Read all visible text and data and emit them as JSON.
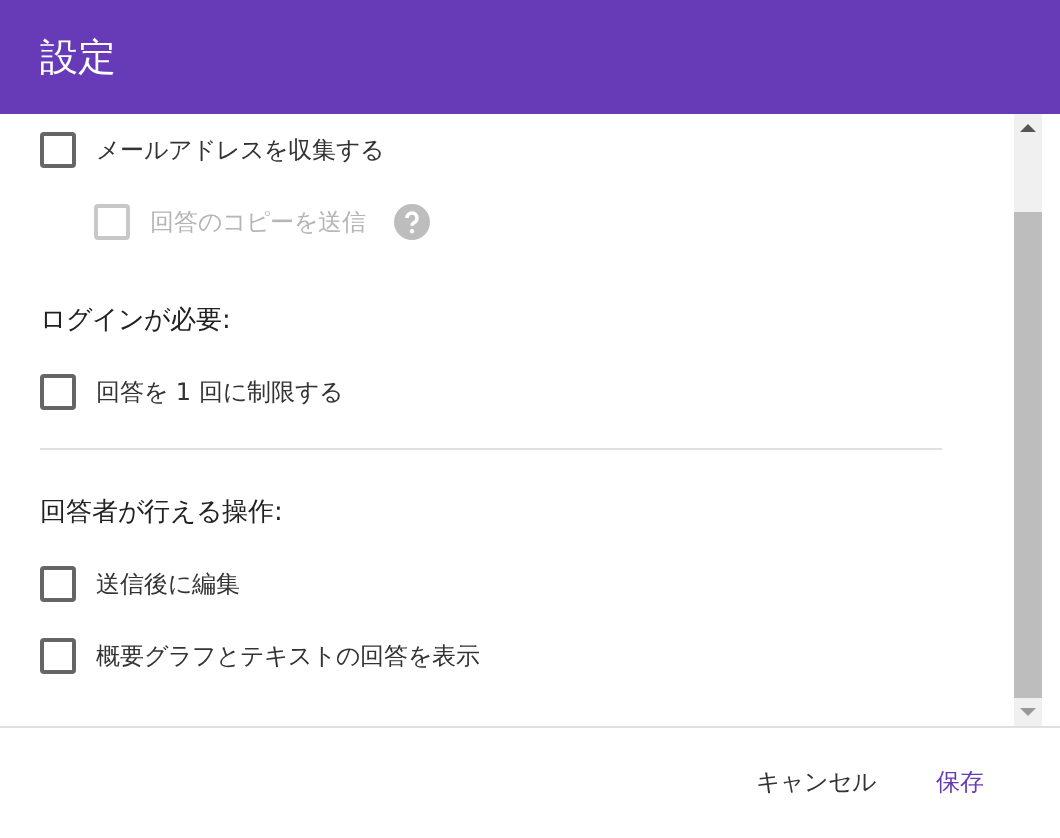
{
  "dialog": {
    "title": "設定"
  },
  "sections": [
    {
      "items": [
        {
          "label": "メールアドレスを収集する",
          "checked": false,
          "disabled": false,
          "children": [
            {
              "label": "回答のコピーを送信",
              "checked": false,
              "disabled": true,
              "help": true
            }
          ]
        }
      ]
    },
    {
      "heading": "ログインが必要:",
      "items": [
        {
          "label": "回答を 1 回に制限する",
          "checked": false,
          "disabled": false
        }
      ]
    },
    {
      "heading": "回答者が行える操作:",
      "divider_above": true,
      "items": [
        {
          "label": "送信後に編集",
          "checked": false,
          "disabled": false
        },
        {
          "label": "概要グラフとテキストの回答を表示",
          "checked": false,
          "disabled": false
        }
      ]
    }
  ],
  "buttons": [
    {
      "label": "キャンセル",
      "kind": "secondary"
    },
    {
      "label": "保存",
      "kind": "primary"
    }
  ]
}
